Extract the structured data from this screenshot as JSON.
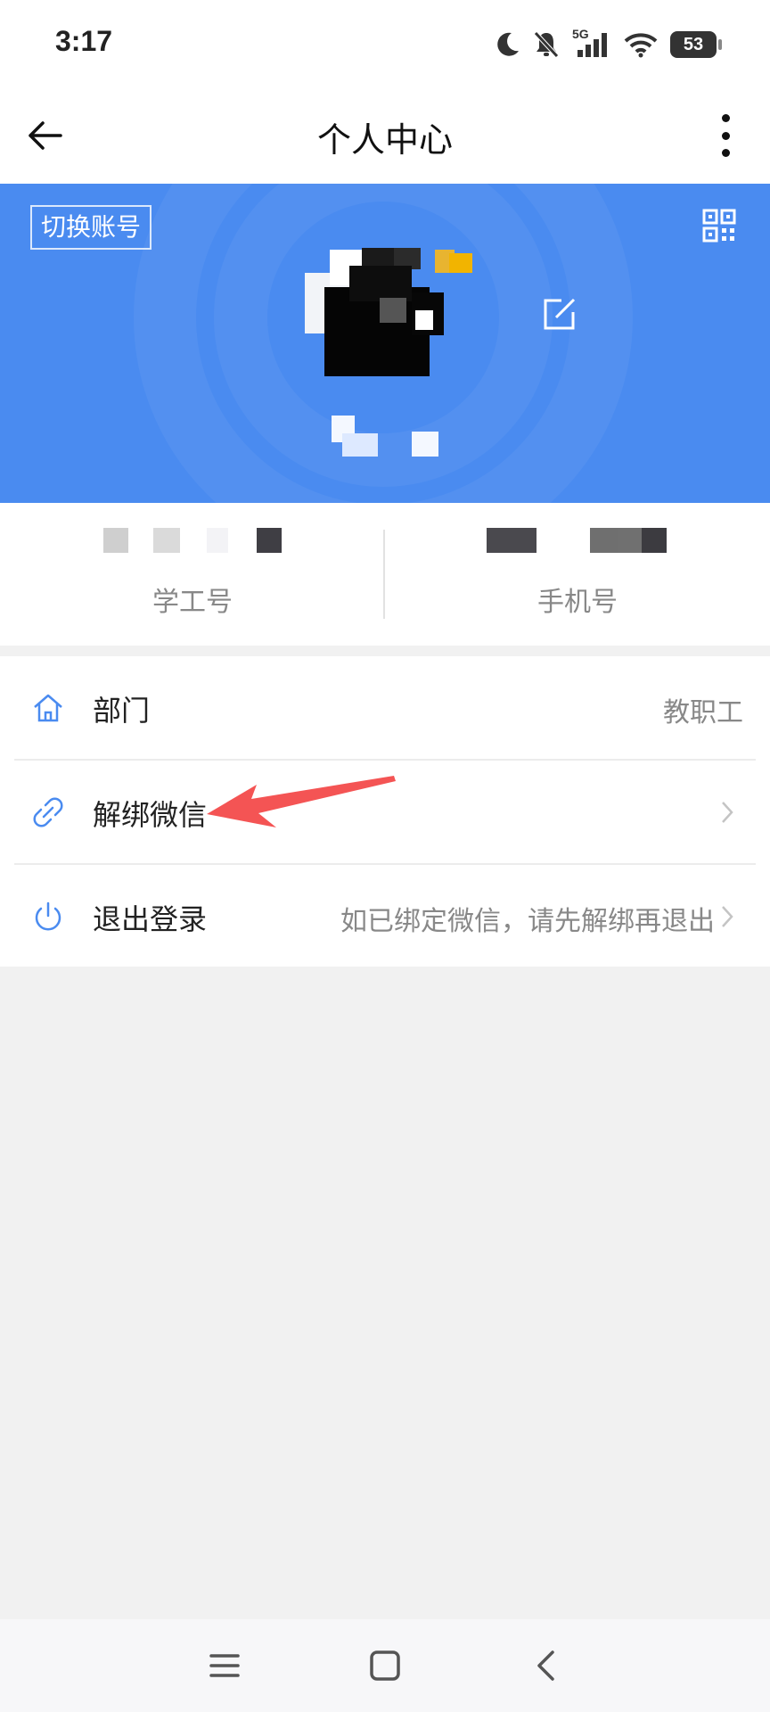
{
  "status_bar": {
    "time": "3:17",
    "network": "5G",
    "battery": "53",
    "icons": [
      "moon-icon",
      "bell-off-icon",
      "signal-icon",
      "wifi-icon",
      "battery-icon"
    ]
  },
  "app_bar": {
    "title": "个人中心",
    "back_icon": "arrow-left-icon",
    "more_icon": "more-vertical-icon"
  },
  "header": {
    "switch_account_label": "切换账号",
    "qr_icon": "qr-code-icon",
    "edit_icon": "edit-icon",
    "accent_color": "#4a8bf0"
  },
  "info": {
    "id_label": "学工号",
    "phone_label": "手机号"
  },
  "menu": {
    "items": [
      {
        "label": "部门",
        "value": "教职工",
        "icon": "home-icon"
      },
      {
        "label": "解绑微信",
        "icon": "unlink-icon",
        "chevron": "chevron-right-icon"
      },
      {
        "label": "退出登录",
        "hint": "如已绑定微信，请先解绑再退出",
        "icon": "power-icon",
        "chevron": "chevron-right-icon"
      }
    ]
  },
  "annotation": {
    "icon": "red-arrow-icon",
    "color": "#f45454"
  },
  "nav_bar": {
    "icons": [
      "menu-icon",
      "home-square-icon",
      "back-chevron-icon"
    ]
  }
}
